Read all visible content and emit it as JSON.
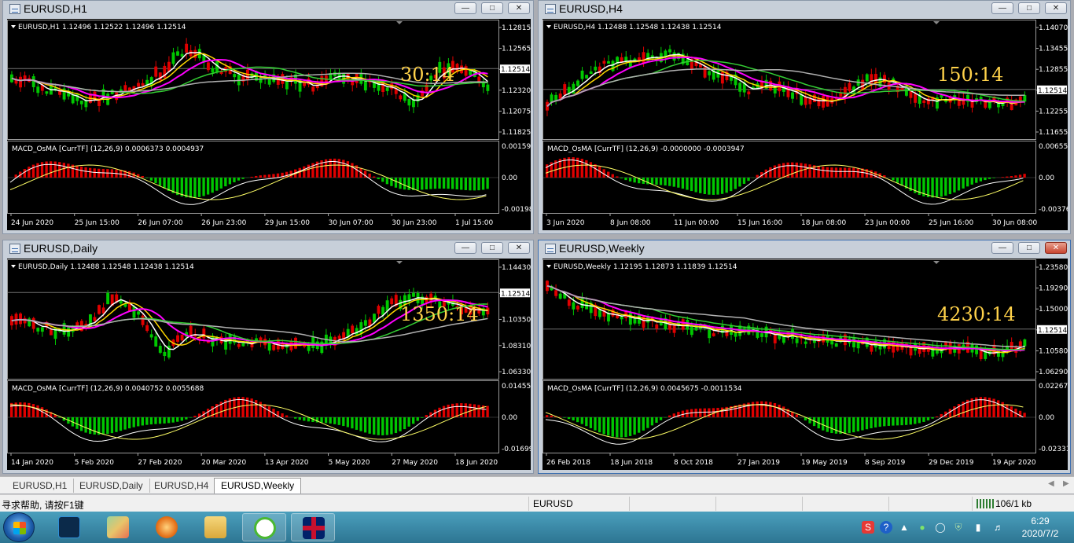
{
  "windows": [
    {
      "id": "h1",
      "title": "EURUSD,H1",
      "info": "EURUSD,H1  1.12496 1.12522 1.12496 1.12514",
      "timer": "30:14",
      "price_labels": [
        "1.12815",
        "1.12565",
        "1.12514",
        "1.12320",
        "1.12075",
        "1.11825"
      ],
      "current_price": "1.12514",
      "macd_title": "MACD_OsMA [CurrTF] (12,26,9) 0.0006373 0.0004937",
      "macd_labels": [
        "0.0015904",
        "0.00",
        "-0.001985"
      ],
      "dates": [
        "24 Jun 2020",
        "25 Jun 15:00",
        "26 Jun 07:00",
        "26 Jun 23:00",
        "29 Jun 15:00",
        "30 Jun 07:00",
        "30 Jun 23:00",
        "1 Jul 15:00"
      ]
    },
    {
      "id": "h4",
      "title": "EURUSD,H4",
      "info": "EURUSD,H4  1.12488 1.12548 1.12438 1.12514",
      "timer": "150:14",
      "price_labels": [
        "1.14070",
        "1.13455",
        "1.12855",
        "1.12514",
        "1.12255",
        "1.11655"
      ],
      "current_price": "1.12514",
      "macd_title": "MACD_OsMA [CurrTF] (12,26,9) -0.0000000 -0.0003947",
      "macd_labels": [
        "0.0065585",
        "0.00",
        "-0.003760"
      ],
      "dates": [
        "3 Jun 2020",
        "8 Jun 08:00",
        "11 Jun 00:00",
        "15 Jun 16:00",
        "18 Jun 08:00",
        "23 Jun 00:00",
        "25 Jun 16:00",
        "30 Jun 08:00"
      ]
    },
    {
      "id": "d1",
      "title": "EURUSD,Daily",
      "info": "EURUSD,Daily  1.12488 1.12548 1.12438 1.12514",
      "timer": "1350:14",
      "price_labels": [
        "1.14430",
        "1.12514",
        "1.10350",
        "1.08310",
        "1.06330"
      ],
      "current_price": "1.12514",
      "macd_title": "MACD_OsMA [CurrTF] (12,26,9) 0.0040752 0.0055688",
      "macd_labels": [
        "0.0145509",
        "0.00",
        "-0.016995"
      ],
      "dates": [
        "14 Jan 2020",
        "5 Feb 2020",
        "27 Feb 2020",
        "20 Mar 2020",
        "13 Apr 2020",
        "5 May 2020",
        "27 May 2020",
        "18 Jun 2020"
      ]
    },
    {
      "id": "w1",
      "title": "EURUSD,Weekly",
      "info": "EURUSD,Weekly  1.12195 1.12873 1.11839 1.12514",
      "timer": "4230:14",
      "price_labels": [
        "1.23580",
        "1.19290",
        "1.15000",
        "1.12514",
        "1.10580",
        "1.06290"
      ],
      "current_price": "1.12514",
      "macd_title": "MACD_OsMA [CurrTF] (12,26,9) 0.0045675 -0.0011534",
      "macd_labels": [
        "0.0226795",
        "0.00",
        "-0.023315"
      ],
      "dates": [
        "26 Feb 2018",
        "18 Jun 2018",
        "8 Oct 2018",
        "27 Jan 2019",
        "19 May 2019",
        "8 Sep 2019",
        "29 Dec 2019",
        "19 Apr 2020"
      ]
    }
  ],
  "tabs": [
    "EURUSD,H1",
    "EURUSD,Daily",
    "EURUSD,H4",
    "EURUSD,Weekly"
  ],
  "active_tab": "EURUSD,Weekly",
  "status": {
    "help": "寻求帮助, 请按F1键",
    "symbol": "EURUSD",
    "traffic": "106/1 kb"
  },
  "clock": {
    "time": "6:29",
    "date": "2020/7/2"
  },
  "colors": {
    "bull": "#00c800",
    "bear": "#e00000",
    "ma_white": "#ffffff",
    "ma_yellow": "#ffd700",
    "ma_magenta": "#ff00ff",
    "ma_green": "#33cc33",
    "ma_gray": "#b0b0b0",
    "timer": "#ffd24a"
  }
}
